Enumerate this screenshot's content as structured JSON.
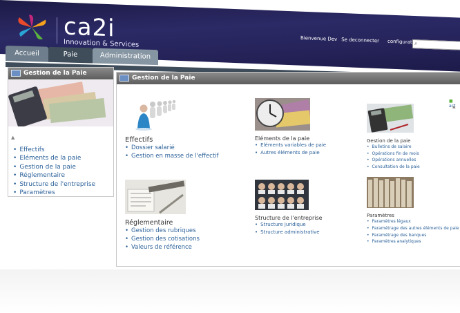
{
  "brand": {
    "name": "ca2i",
    "tagline": "Innovation & Services",
    "colors": {
      "header": "#2c2a66",
      "link": "#2b6199",
      "panel_head": "#6b6b6b"
    }
  },
  "topnav": {
    "welcome": "Bienvenue Dev",
    "logout": "Se deconnecter",
    "configuration": "configuration"
  },
  "tabs": [
    {
      "label": "Accueil"
    },
    {
      "label": "Paie"
    },
    {
      "label": "Administration"
    }
  ],
  "sidebar": {
    "title": "Gestion de la Paie",
    "items": [
      {
        "label": "Effectifs"
      },
      {
        "label": "Eléments de la paie"
      },
      {
        "label": "Gestion de la paie"
      },
      {
        "label": "Réglementaire"
      },
      {
        "label": "Structure de l'entreprise"
      },
      {
        "label": "Paramètres"
      }
    ]
  },
  "main": {
    "title": "Gestion de la Paie",
    "blocks": [
      {
        "title": "Effectifs",
        "links": [
          "Dossier salarié",
          "Gestion en masse de l'effectif"
        ]
      },
      {
        "title": "Eléments de la paie",
        "links": [
          "Eléments variables de paie",
          "Autres éléments de paie"
        ]
      },
      {
        "title": "Gestion de la paie",
        "links": [
          "Bulletins de salaire",
          "Opérations fin de mois",
          "Opérations annuelles",
          "Consultation de la paie"
        ]
      },
      {
        "title": "Réglementaire",
        "links": [
          "Gestion des rubriques",
          "Gestion des cotisations",
          "Valeurs de référence"
        ]
      },
      {
        "title": "Structure de l'entreprise",
        "links": [
          "Structure juridique",
          "Structure administrative"
        ]
      },
      {
        "title": "Paramètres",
        "links": [
          "Paramètres légaux",
          "Paramétrage des autres éléments de paie",
          "Paramétrage des banques",
          "Paramètres analytiques"
        ]
      }
    ],
    "side_note": "act"
  },
  "icons": {
    "logo": "pinwheel-logo",
    "search": "search-icon",
    "effectifs": "people-icon",
    "elements": "clock-money-icon",
    "gestion": "calculator-icon",
    "reglementaire": "document-ruler-icon",
    "structure": "team-photo-icon",
    "parametres": "binders-icon"
  }
}
